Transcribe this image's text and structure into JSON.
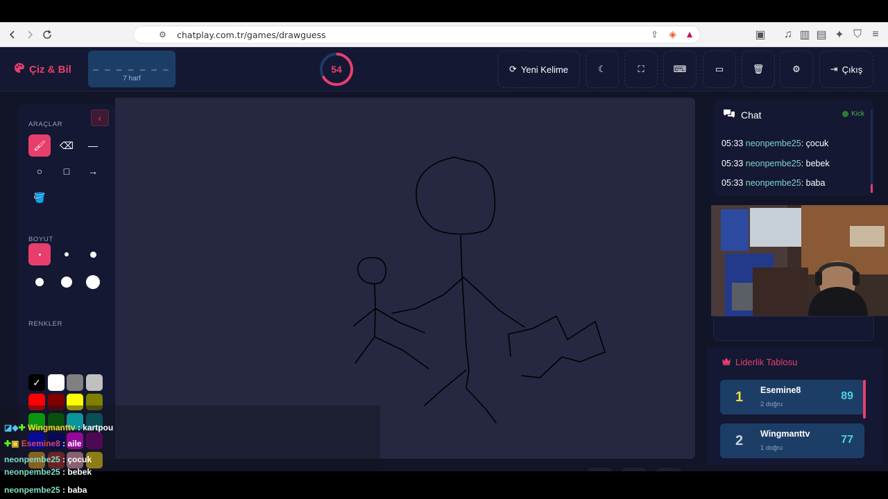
{
  "browser": {
    "url": "chatplay.com.tr/games/drawguess"
  },
  "app": {
    "logo": "Çiz & Bil",
    "word": {
      "blanks": "_ _ _ _ _ _ _",
      "hint": "7 harf"
    },
    "timer": "54",
    "header_buttons": {
      "new_word": "Yeni Kelime",
      "exit": "Çıkış"
    }
  },
  "tools": {
    "sections": {
      "tools": "ARAÇLAR",
      "size": "BOYUT",
      "colors": "RENKLER"
    },
    "colors": [
      "#000000",
      "#ffffff",
      "#808080",
      "#c0c0c0",
      "#ff0000",
      "#800000",
      "#ffff00",
      "#808000",
      "#00ff00",
      "#008000",
      "#00ffff",
      "#008080",
      "#0000ff",
      "#000080",
      "#ff00ff",
      "#800080",
      "#e6a020",
      "#b03030",
      "#e8a0b0",
      "#f0d010"
    ]
  },
  "chat": {
    "title": "Chat",
    "kick_label": "Kick",
    "messages": [
      {
        "time": "05:33",
        "user": "neonpembe25",
        "text": "çocuk"
      },
      {
        "time": "05:33",
        "user": "neonpembe25",
        "text": "bebek"
      },
      {
        "time": "05:33",
        "user": "neonpembe25",
        "text": "baba"
      }
    ]
  },
  "leaderboard": {
    "title": "Liderlik Tablosu",
    "entries": [
      {
        "rank": "1",
        "name": "Esemine8",
        "sub": "2 doğru",
        "score": "89",
        "rank_color": "#f5d742"
      },
      {
        "rank": "2",
        "name": "Wingmanttv",
        "sub": "1 doğru",
        "score": "77",
        "rank_color": "#c9d2de"
      }
    ]
  },
  "stream_overlay": {
    "lines": [
      {
        "user": "Wingmanttv",
        "text": "kartpou"
      },
      {
        "user": "Esemine8",
        "text": "aile"
      },
      {
        "user": "neonpembe25",
        "text": "çocuk"
      },
      {
        "user": "neonpembe25",
        "text": "bebek"
      },
      {
        "user": "neonpembe25",
        "text": "baba"
      }
    ]
  }
}
